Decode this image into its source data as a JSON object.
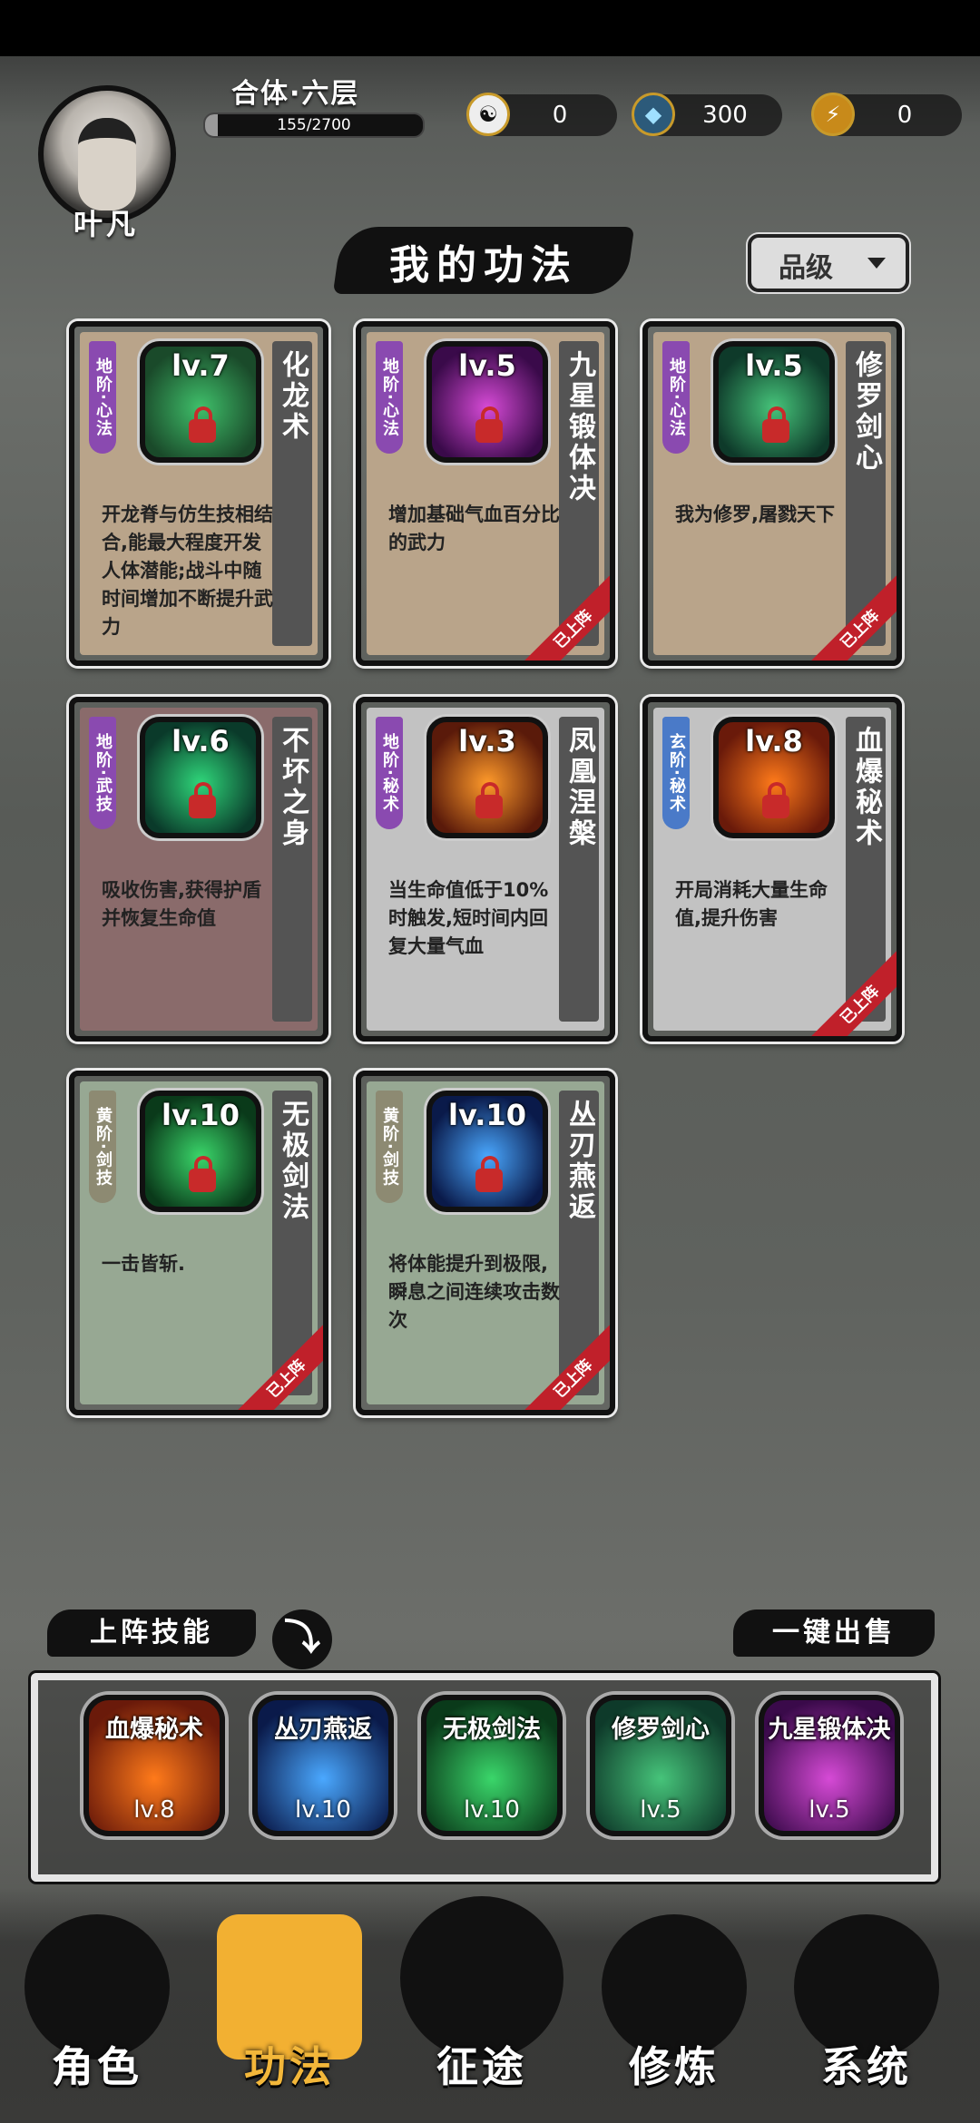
{
  "player": {
    "name": "叶凡",
    "realm": "合体·六层",
    "xp_text": "155/2700",
    "xp_progress": 0.057
  },
  "currencies": [
    {
      "icon": "yin-yang-icon",
      "value": "0",
      "symbol": "☯"
    },
    {
      "icon": "crystal-icon",
      "value": "300",
      "symbol": "◆"
    },
    {
      "icon": "lightning-icon",
      "value": "0",
      "symbol": "⚡"
    }
  ],
  "section_title": "我的功法",
  "grade_filter": {
    "label": "品级"
  },
  "cards": [
    {
      "tag": "地阶·心法",
      "level": "lv.7",
      "name": "化龙术",
      "desc": "开龙脊与仿生技相结合,能最大程度开发人体潜能;战斗中随时间增加不断提升武力",
      "equipped": false,
      "bg": "#b9a48a",
      "tagColor": "#8a4ab0",
      "iconColors": [
        "#1a4a2a",
        "#3fbf6a"
      ]
    },
    {
      "tag": "地阶·心法",
      "level": "lv.5",
      "name": "九星锻体决",
      "desc": "增加基础气血百分比的武力",
      "equipped": true,
      "bg": "#b9a48a",
      "tagColor": "#8a4ab0",
      "iconColors": [
        "#3a0a4a",
        "#d64ad6"
      ]
    },
    {
      "tag": "地阶·心法",
      "level": "lv.5",
      "name": "修罗剑心",
      "desc": "我为修罗,屠戮天下",
      "equipped": true,
      "bg": "#b9a48a",
      "tagColor": "#8a4ab0",
      "iconColors": [
        "#0e3a2a",
        "#46c47a"
      ]
    },
    {
      "tag": "地阶·武技",
      "level": "lv.6",
      "name": "不坏之身",
      "desc": "吸收伤害,获得护盾并恢复生命值",
      "equipped": false,
      "bg": "#8a6b6b",
      "tagColor": "#8a4ab0",
      "iconColors": [
        "#0a3a2a",
        "#2fd67a"
      ]
    },
    {
      "tag": "地阶·秘术",
      "level": "lv.3",
      "name": "凤凰涅槃",
      "desc": "当生命值低于10%时触发,短时间内回复大量气血",
      "equipped": false,
      "bg": "#c2c2c2",
      "tagColor": "#8a4ab0",
      "iconColors": [
        "#5a1a0a",
        "#ff9a2a"
      ]
    },
    {
      "tag": "玄阶·秘术",
      "level": "lv.8",
      "name": "血爆秘术",
      "desc": "开局消耗大量生命值,提升伤害",
      "equipped": true,
      "bg": "#c2c2c2",
      "tagColor": "#4a7ac8",
      "iconColors": [
        "#6a1a0a",
        "#ff7a1a"
      ]
    },
    {
      "tag": "黄阶·剑技",
      "level": "lv.10",
      "name": "无极剑法",
      "desc": "一击皆斩.",
      "equipped": true,
      "bg": "#97a893",
      "tagColor": "#8d8a72",
      "iconColors": [
        "#0a3a1a",
        "#3ad66a"
      ]
    },
    {
      "tag": "黄阶·剑技",
      "level": "lv.10",
      "name": "丛刃燕返",
      "desc": "将体能提升到极限,瞬息之间连续攻击数次",
      "equipped": true,
      "bg": "#97a893",
      "tagColor": "#8d8a72",
      "iconColors": [
        "#0a1a4a",
        "#4aa8ff"
      ]
    }
  ],
  "equipped_badge": "已上阵",
  "lineup": {
    "label": "上阵技能",
    "sell_all": "一键出售",
    "slots": [
      {
        "name": "血爆秘术",
        "level": "lv.8",
        "iconColors": [
          "#6a1a0a",
          "#ff7a1a"
        ]
      },
      {
        "name": "丛刃燕返",
        "level": "lv.10",
        "iconColors": [
          "#0a1a4a",
          "#4aa8ff"
        ]
      },
      {
        "name": "无极剑法",
        "level": "lv.10",
        "iconColors": [
          "#0a3a1a",
          "#3ad66a"
        ]
      },
      {
        "name": "修罗剑心",
        "level": "lv.5",
        "iconColors": [
          "#0e3a2a",
          "#46c47a"
        ]
      },
      {
        "name": "九星锻体决",
        "level": "lv.5",
        "iconColors": [
          "#3a0a4a",
          "#d64ad6"
        ]
      }
    ]
  },
  "nav": [
    {
      "label": "角色",
      "icon": "character-icon",
      "active": false
    },
    {
      "label": "功法",
      "icon": "scroll-icon",
      "active": true
    },
    {
      "label": "征途",
      "icon": "sword-icon",
      "active": false
    },
    {
      "label": "修炼",
      "icon": "meditation-icon",
      "active": false
    },
    {
      "label": "系统",
      "icon": "system-icon",
      "active": false
    }
  ]
}
